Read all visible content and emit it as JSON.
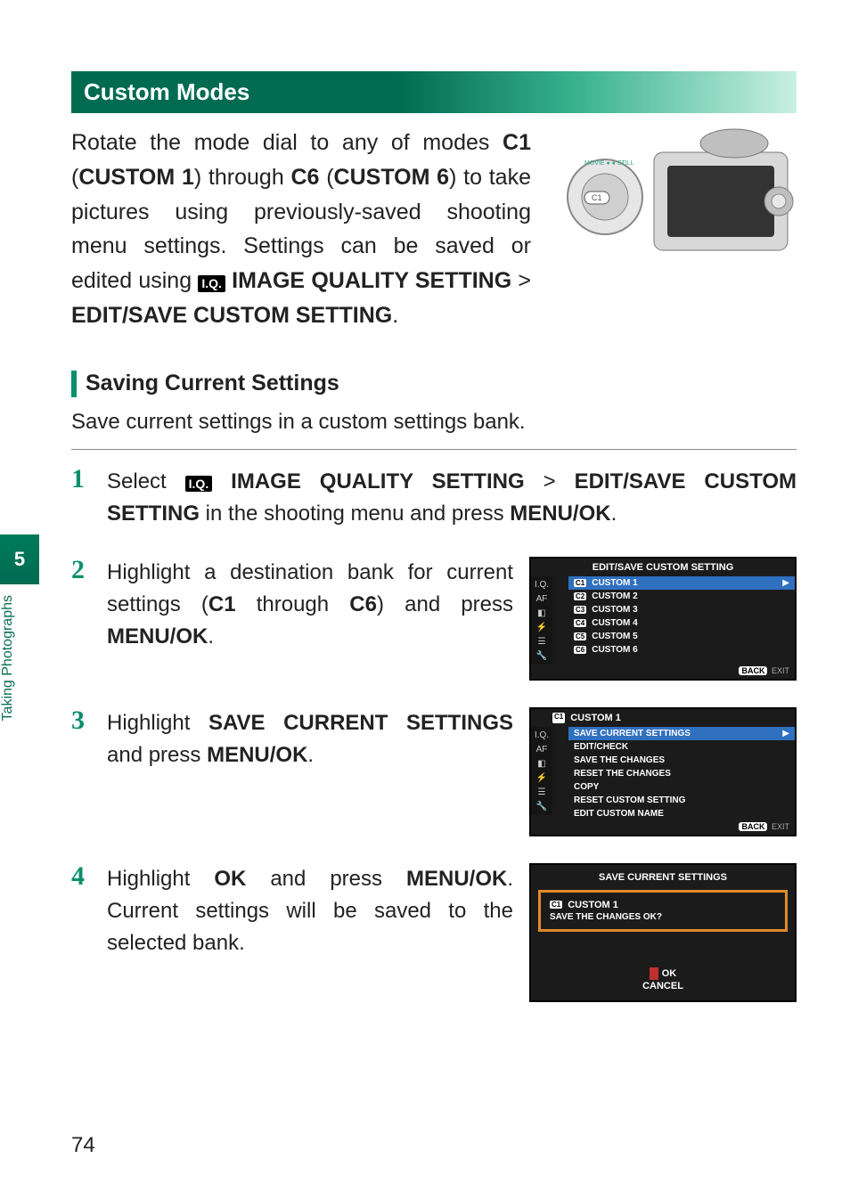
{
  "side": {
    "chapter_num": "5",
    "chapter_title": "Taking Photographs"
  },
  "section_header": "Custom Modes",
  "intro": {
    "p1a": "Rotate the mode dial to any of modes ",
    "c1": "C1",
    "p1b": " (",
    "custom1": "CUSTOM 1",
    "p1c": ") through ",
    "c6": "C6",
    "p1d": " (",
    "custom6": "CUSTOM 6",
    "p1e": ") to take pictures using previously-saved shooting menu settings. Settings can be saved or edited using ",
    "iq": "I.Q.",
    "iqs": " IMAGE QUALITY SETTING",
    "gt": " > ",
    "edit": "EDIT/SAVE CUSTOM SETTING",
    "period": "."
  },
  "sub_heading": "Saving Current Settings",
  "lead": "Save current settings in a custom settings bank.",
  "steps": {
    "s1": {
      "num": "1",
      "a": "Select ",
      "iq": "I.Q.",
      "b": " IMAGE QUALITY SETTING",
      "gt": " > ",
      "c": "EDIT/SAVE CUSTOM SETTING",
      "d": " in the shooting menu and press ",
      "e": "MENU/OK",
      "f": "."
    },
    "s2": {
      "num": "2",
      "a": "Highlight a destination bank for current settings (",
      "b": "C1",
      "c": " through ",
      "d": "C6",
      "e": ") and press ",
      "f": "MENU/OK",
      "g": "."
    },
    "s3": {
      "num": "3",
      "a": "Highlight ",
      "b": "SAVE CURRENT SETTINGS",
      "c": " and press ",
      "d": "MENU/OK",
      "e": "."
    },
    "s4": {
      "num": "4",
      "a": "Highlight ",
      "b": "OK",
      "c": " and press ",
      "d": "MENU/OK",
      "e": ". Current settings will be saved to the selected bank."
    }
  },
  "lcd1": {
    "title": "EDIT/SAVE CUSTOM SETTING",
    "items": [
      {
        "badge": "C1",
        "label": "CUSTOM 1",
        "sel": true
      },
      {
        "badge": "C2",
        "label": "CUSTOM 2"
      },
      {
        "badge": "C3",
        "label": "CUSTOM 3"
      },
      {
        "badge": "C4",
        "label": "CUSTOM 4"
      },
      {
        "badge": "C5",
        "label": "CUSTOM 5"
      },
      {
        "badge": "C6",
        "label": "CUSTOM 6"
      }
    ],
    "back": "BACK",
    "exit": "EXIT"
  },
  "lcd2": {
    "badge": "C1",
    "title": "CUSTOM 1",
    "items": [
      {
        "label": "SAVE CURRENT SETTINGS",
        "sel": true
      },
      {
        "label": "EDIT/CHECK"
      },
      {
        "label": "SAVE THE CHANGES"
      },
      {
        "label": "RESET THE CHANGES"
      },
      {
        "label": "COPY"
      },
      {
        "label": "RESET CUSTOM SETTING"
      },
      {
        "label": "EDIT CUSTOM NAME"
      }
    ],
    "back": "BACK",
    "exit": "EXIT"
  },
  "dlg": {
    "title": "SAVE CURRENT SETTINGS",
    "badge": "C1",
    "bank": "CUSTOM 1",
    "confirm": "SAVE THE CHANGES OK?",
    "ok": "OK",
    "cancel": "CANCEL"
  },
  "camera_label": "MOVIE ● ● STILL",
  "camera_c1": "C1",
  "page_number": "74"
}
